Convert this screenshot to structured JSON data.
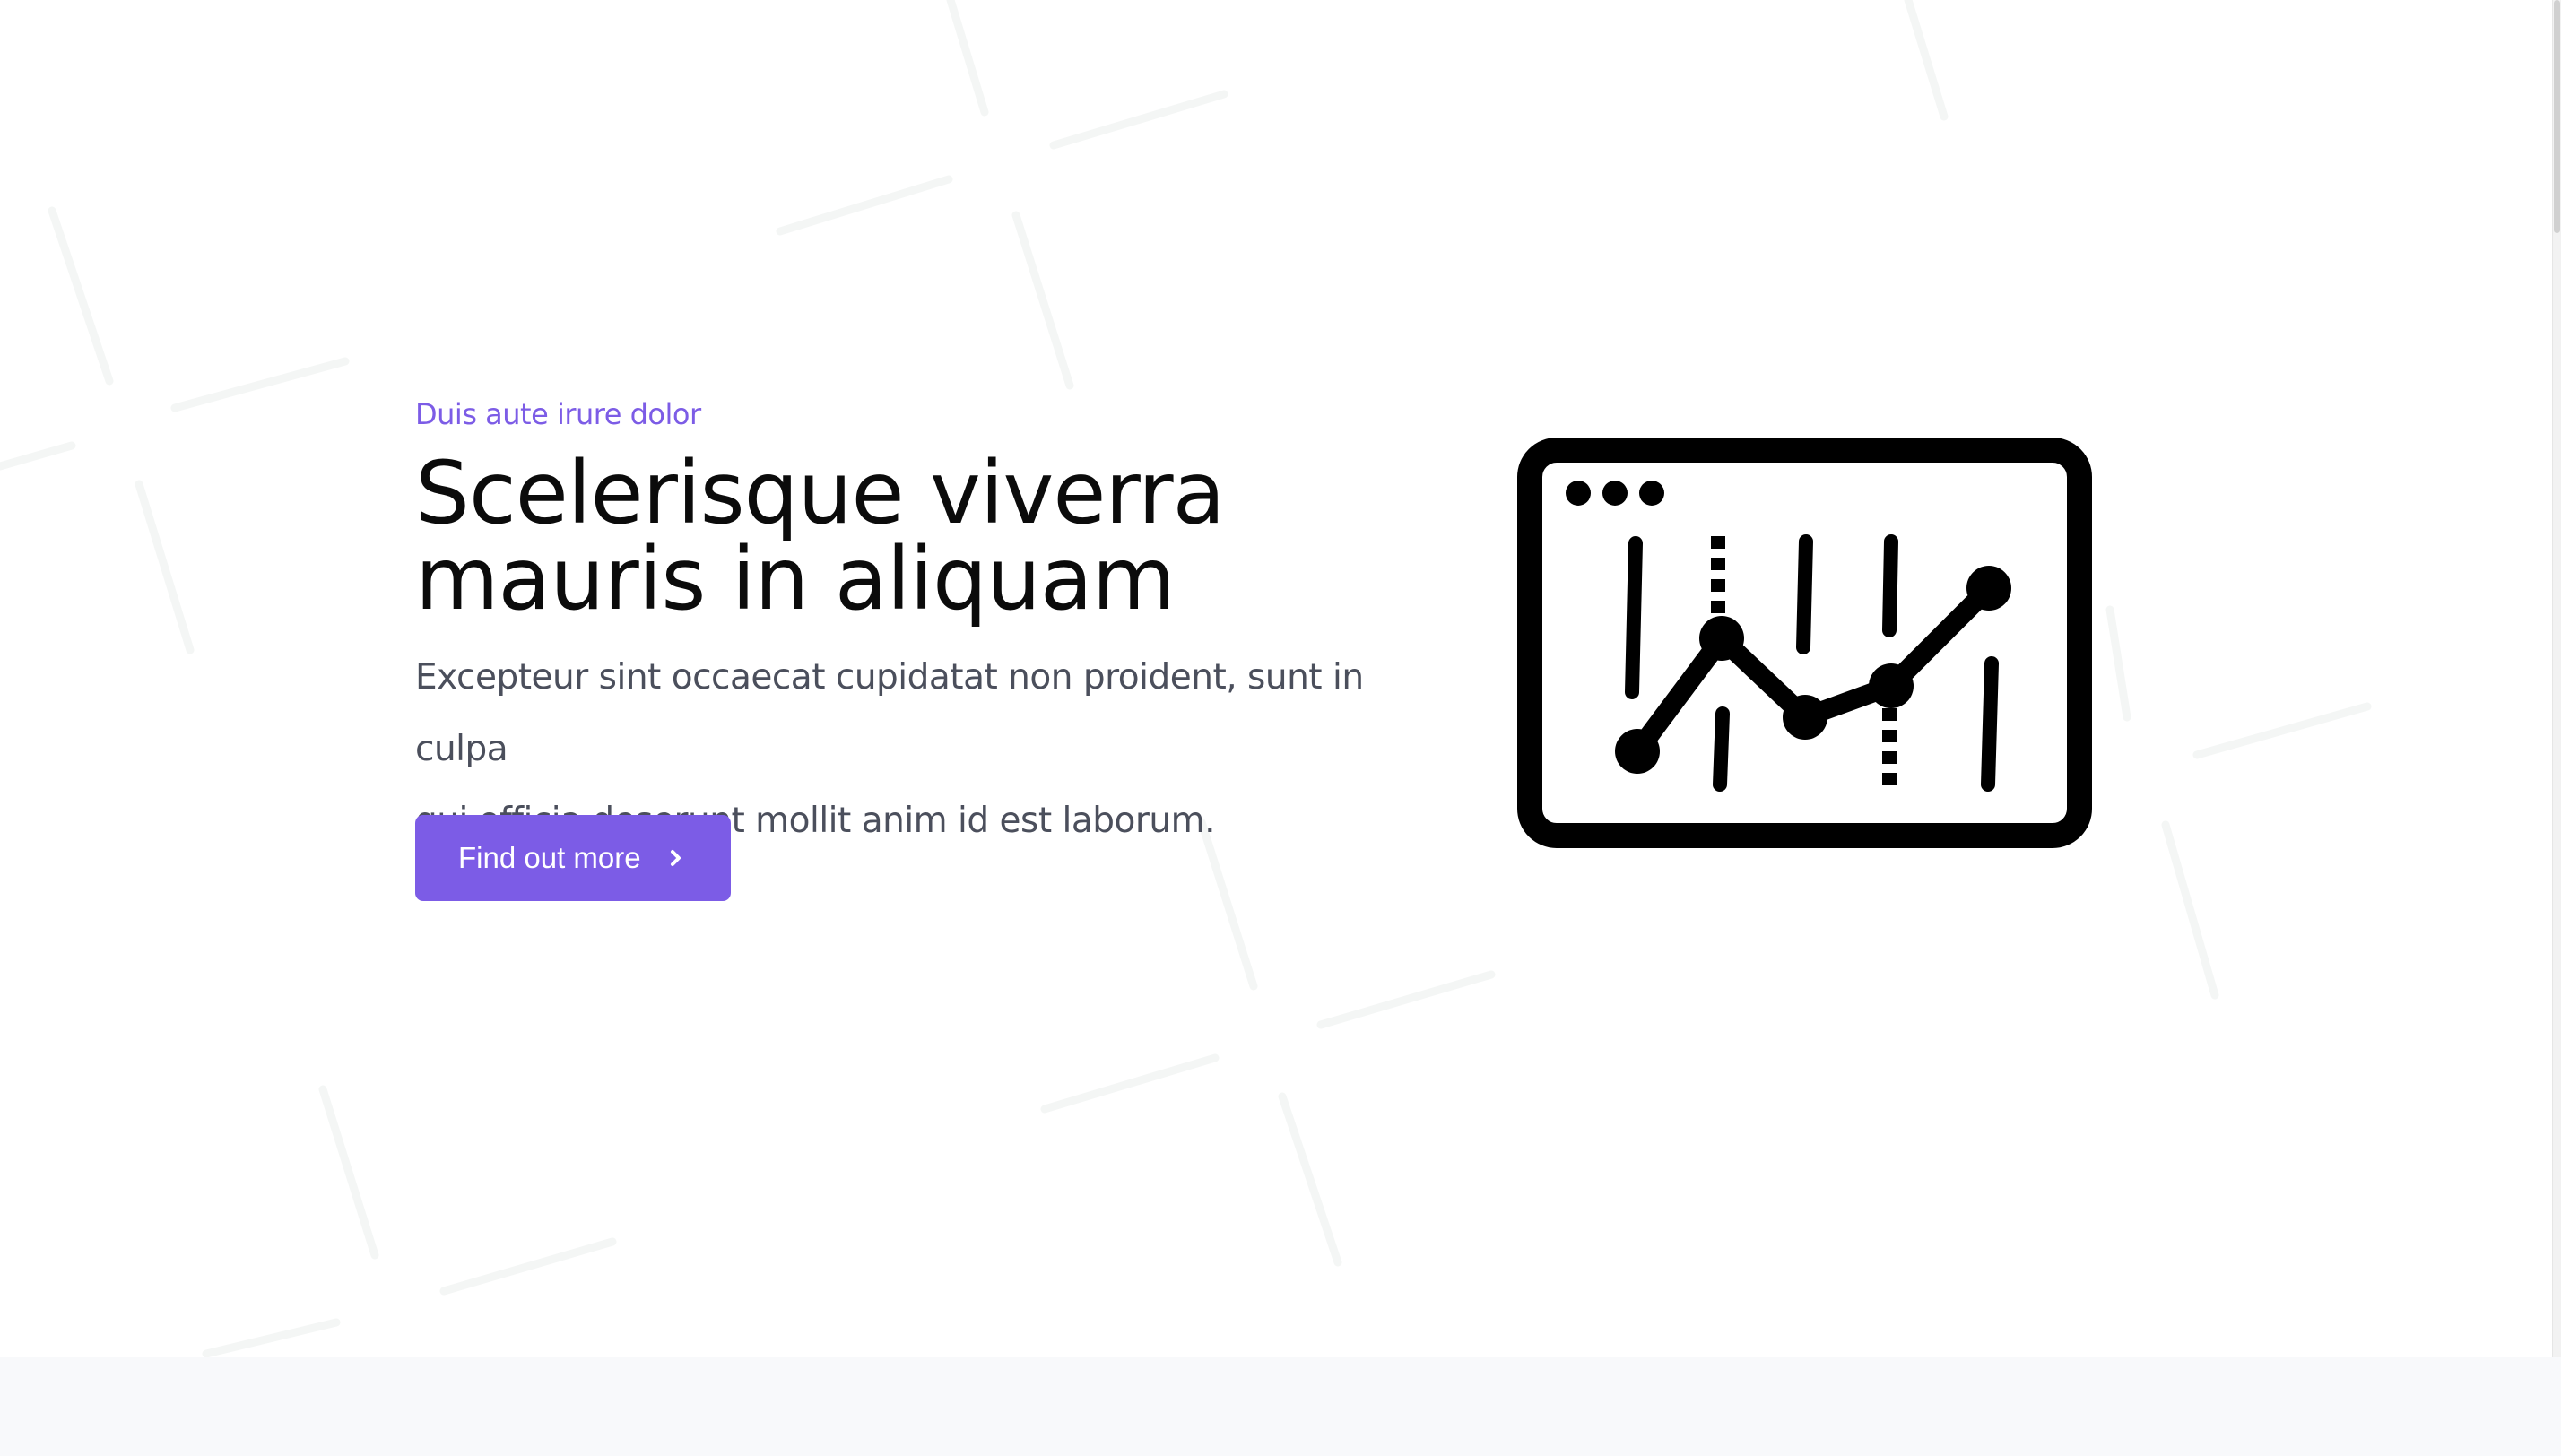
{
  "hero": {
    "eyebrow": "Duis aute irure dolor",
    "title_lines": [
      "Scelerisque viverra",
      "mauris in aliquam"
    ],
    "lead_lines": [
      "Excepteur sint occaecat cupidatat non proident, sunt in culpa",
      "qui officia deserunt mollit anim id est laborum."
    ],
    "cta": {
      "label": "Find out more",
      "icon": "chevron-right-icon"
    },
    "illustration_icon": "analytics-chart-window-icon"
  },
  "colors": {
    "accent": "#7c5ce6",
    "heading": "#0b0b0b",
    "body_text": "#4b4f5c",
    "background": "#ffffff",
    "next_section_background": "#f8f9fb"
  }
}
